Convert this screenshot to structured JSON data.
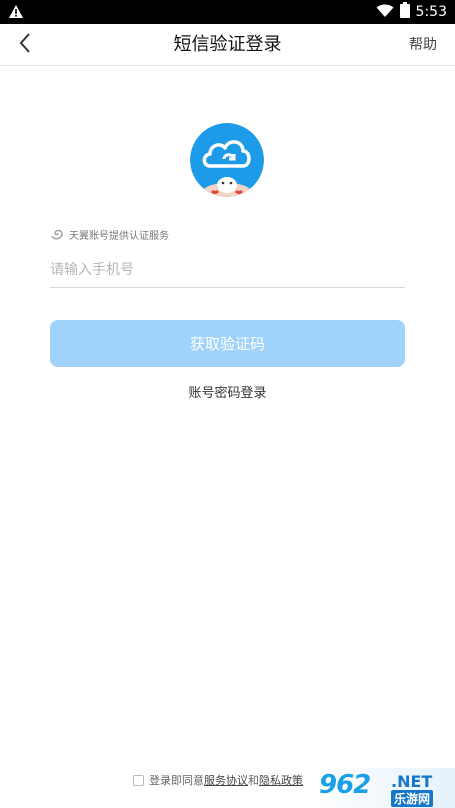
{
  "status_bar": {
    "time": "5:53",
    "warning_icon": "warning-icon",
    "wifi_icon": "wifi-icon",
    "battery_icon": "battery-icon"
  },
  "header": {
    "title": "短信验证登录",
    "help_label": "帮助",
    "back_icon": "chevron-left-icon"
  },
  "provider": {
    "icon": "swirl-icon",
    "text": "天翼账号提供认证服务"
  },
  "phone_input": {
    "placeholder": "请输入手机号",
    "value": ""
  },
  "get_code_button": {
    "label": "获取验证码",
    "color": "#9fd3fb"
  },
  "password_login": {
    "label": "账号密码登录"
  },
  "agreement": {
    "prefix": "登录即同意",
    "service_link": "服务协议",
    "conjunction": "和",
    "privacy_link": "隐私政策",
    "checked": false
  },
  "watermark": {
    "brand": "962",
    "suffix": ".NET",
    "cn_label": "乐游网"
  },
  "colors": {
    "accent": "#1e9be8",
    "button_disabled": "#9fd3fb"
  }
}
